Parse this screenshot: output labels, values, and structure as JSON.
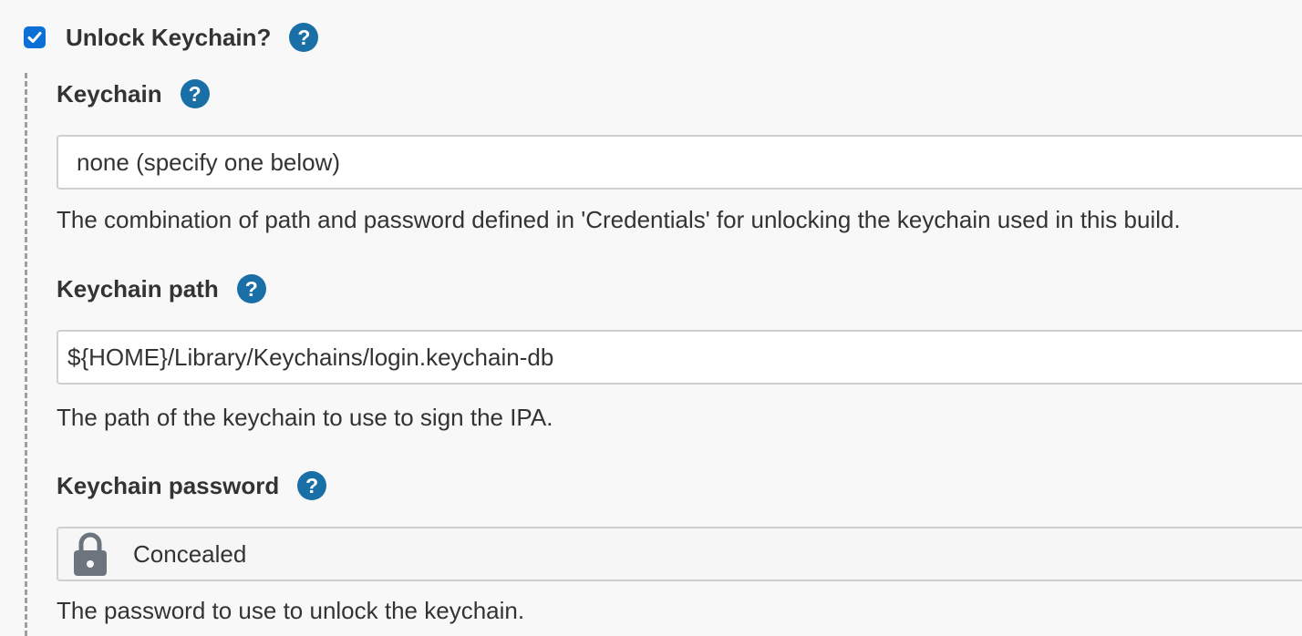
{
  "unlock_keychain": {
    "label": "Unlock Keychain?",
    "checked": true,
    "help_icon": "help-icon"
  },
  "keychain": {
    "label": "Keychain",
    "selected_value": "none (specify one below)",
    "description": "The combination of path and password defined in 'Credentials' for unlocking the keychain used in this build."
  },
  "keychain_path": {
    "label": "Keychain path",
    "value": "${HOME}/Library/Keychains/login.keychain-db",
    "description": "The path of the keychain to use to sign the IPA."
  },
  "keychain_password": {
    "label": "Keychain password",
    "value": "Concealed",
    "icon": "lock-icon",
    "description": "The password to use to unlock the keychain."
  },
  "help_glyph": "?",
  "colors": {
    "accent": "#0b6fd6",
    "help": "#1a6fa6",
    "background": "#f8f8f8"
  }
}
